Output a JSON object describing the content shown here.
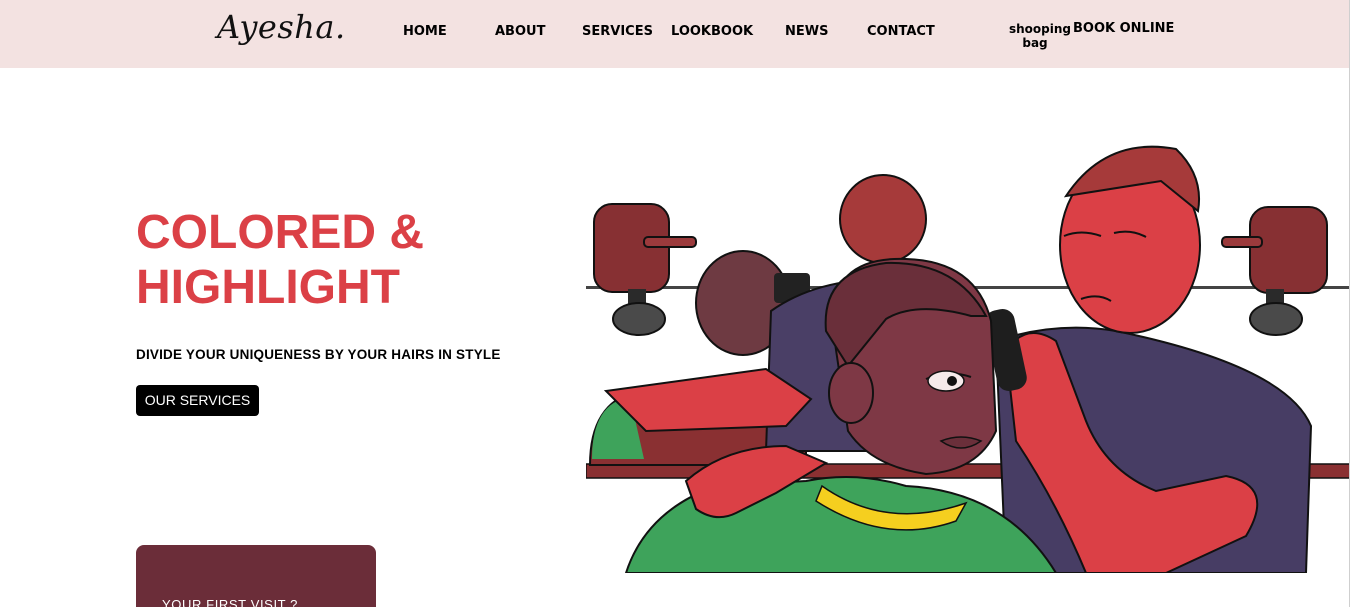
{
  "brand": {
    "logo_text": "Ayesha."
  },
  "nav": {
    "items": [
      {
        "label": "HOME"
      },
      {
        "label": "ABOUT"
      },
      {
        "label": "SERVICES"
      },
      {
        "label": "LOOKBOOK"
      },
      {
        "label": "NEWS"
      },
      {
        "label": "CONTACT"
      }
    ],
    "shopping_bag_line1": "shooping",
    "shopping_bag_line2": "bag",
    "book_online": "BOOK ONLINE"
  },
  "hero": {
    "title_line1": "COLORED &",
    "title_line2": "HIGHLIGHT",
    "subtitle": "DIVIDE YOUR UNIQUENESS BY YOUR HAIRS IN STYLE",
    "cta_label": "OUR SERVICES"
  },
  "visit_card": {
    "title": "YOUR FIRST VISIT ?"
  },
  "colors": {
    "header_bg": "#f3e2e1",
    "accent_red": "#db4046",
    "card_bg": "#6b2d39",
    "cta_bg": "#000000"
  }
}
